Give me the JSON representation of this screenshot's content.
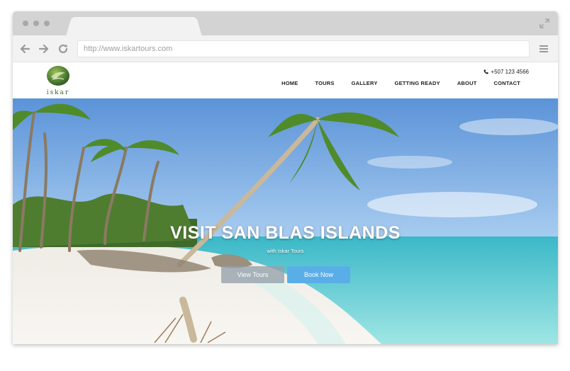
{
  "browser": {
    "url": "http://www.iskartours.com"
  },
  "site": {
    "logo_text": "iskar",
    "phone": "+507 123 4566",
    "nav": [
      "HOME",
      "TOURS",
      "GALLERY",
      "GETTING READY",
      "ABOUT",
      "CONTACT"
    ]
  },
  "hero": {
    "title": "VISIT SAN BLAS ISLANDS",
    "subtitle": "with Iskar Tours",
    "primary_button": "Book Now",
    "secondary_button": "View Tours"
  },
  "icons": [
    "back-arrow-icon",
    "forward-arrow-icon",
    "reload-icon",
    "expand-icon",
    "hamburger-menu-icon",
    "phone-icon"
  ],
  "colors": {
    "accent": "#5aaee8",
    "logo_green": "#3c6a2b"
  }
}
